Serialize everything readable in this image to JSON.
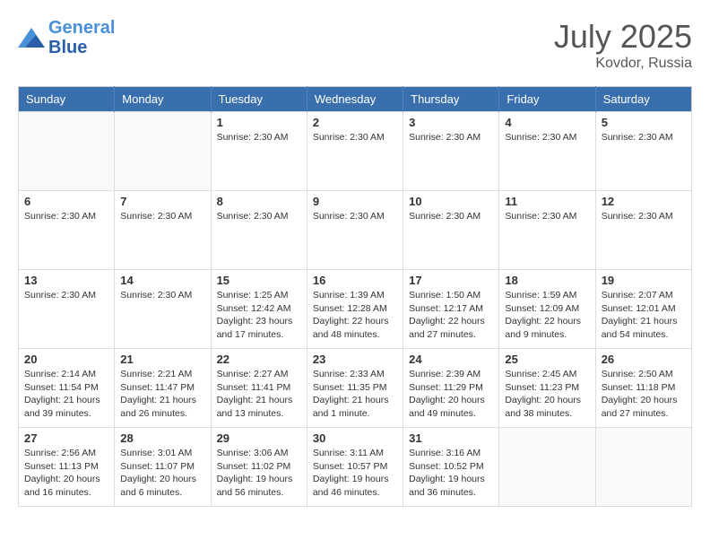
{
  "header": {
    "logo_line1": "General",
    "logo_line2": "Blue",
    "month_year": "July 2025",
    "location": "Kovdor, Russia"
  },
  "weekdays": [
    "Sunday",
    "Monday",
    "Tuesday",
    "Wednesday",
    "Thursday",
    "Friday",
    "Saturday"
  ],
  "weeks": [
    [
      {
        "day": "",
        "info": ""
      },
      {
        "day": "",
        "info": ""
      },
      {
        "day": "1",
        "info": "Sunrise: 2:30 AM"
      },
      {
        "day": "2",
        "info": "Sunrise: 2:30 AM"
      },
      {
        "day": "3",
        "info": "Sunrise: 2:30 AM"
      },
      {
        "day": "4",
        "info": "Sunrise: 2:30 AM"
      },
      {
        "day": "5",
        "info": "Sunrise: 2:30 AM"
      }
    ],
    [
      {
        "day": "6",
        "info": "Sunrise: 2:30 AM"
      },
      {
        "day": "7",
        "info": "Sunrise: 2:30 AM"
      },
      {
        "day": "8",
        "info": "Sunrise: 2:30 AM"
      },
      {
        "day": "9",
        "info": "Sunrise: 2:30 AM"
      },
      {
        "day": "10",
        "info": "Sunrise: 2:30 AM"
      },
      {
        "day": "11",
        "info": "Sunrise: 2:30 AM"
      },
      {
        "day": "12",
        "info": "Sunrise: 2:30 AM"
      }
    ],
    [
      {
        "day": "13",
        "info": "Sunrise: 2:30 AM"
      },
      {
        "day": "14",
        "info": "Sunrise: 2:30 AM"
      },
      {
        "day": "15",
        "info": "Sunrise: 1:25 AM\nSunset: 12:42 AM\nDaylight: 23 hours and 17 minutes."
      },
      {
        "day": "16",
        "info": "Sunrise: 1:39 AM\nSunset: 12:28 AM\nDaylight: 22 hours and 48 minutes."
      },
      {
        "day": "17",
        "info": "Sunrise: 1:50 AM\nSunset: 12:17 AM\nDaylight: 22 hours and 27 minutes."
      },
      {
        "day": "18",
        "info": "Sunrise: 1:59 AM\nSunset: 12:09 AM\nDaylight: 22 hours and 9 minutes."
      },
      {
        "day": "19",
        "info": "Sunrise: 2:07 AM\nSunset: 12:01 AM\nDaylight: 21 hours and 54 minutes."
      }
    ],
    [
      {
        "day": "20",
        "info": "Sunrise: 2:14 AM\nSunset: 11:54 PM\nDaylight: 21 hours and 39 minutes."
      },
      {
        "day": "21",
        "info": "Sunrise: 2:21 AM\nSunset: 11:47 PM\nDaylight: 21 hours and 26 minutes."
      },
      {
        "day": "22",
        "info": "Sunrise: 2:27 AM\nSunset: 11:41 PM\nDaylight: 21 hours and 13 minutes."
      },
      {
        "day": "23",
        "info": "Sunrise: 2:33 AM\nSunset: 11:35 PM\nDaylight: 21 hours and 1 minute."
      },
      {
        "day": "24",
        "info": "Sunrise: 2:39 AM\nSunset: 11:29 PM\nDaylight: 20 hours and 49 minutes."
      },
      {
        "day": "25",
        "info": "Sunrise: 2:45 AM\nSunset: 11:23 PM\nDaylight: 20 hours and 38 minutes."
      },
      {
        "day": "26",
        "info": "Sunrise: 2:50 AM\nSunset: 11:18 PM\nDaylight: 20 hours and 27 minutes."
      }
    ],
    [
      {
        "day": "27",
        "info": "Sunrise: 2:56 AM\nSunset: 11:13 PM\nDaylight: 20 hours and 16 minutes."
      },
      {
        "day": "28",
        "info": "Sunrise: 3:01 AM\nSunset: 11:07 PM\nDaylight: 20 hours and 6 minutes."
      },
      {
        "day": "29",
        "info": "Sunrise: 3:06 AM\nSunset: 11:02 PM\nDaylight: 19 hours and 56 minutes."
      },
      {
        "day": "30",
        "info": "Sunrise: 3:11 AM\nSunset: 10:57 PM\nDaylight: 19 hours and 46 minutes."
      },
      {
        "day": "31",
        "info": "Sunrise: 3:16 AM\nSunset: 10:52 PM\nDaylight: 19 hours and 36 minutes."
      },
      {
        "day": "",
        "info": ""
      },
      {
        "day": "",
        "info": ""
      }
    ]
  ]
}
